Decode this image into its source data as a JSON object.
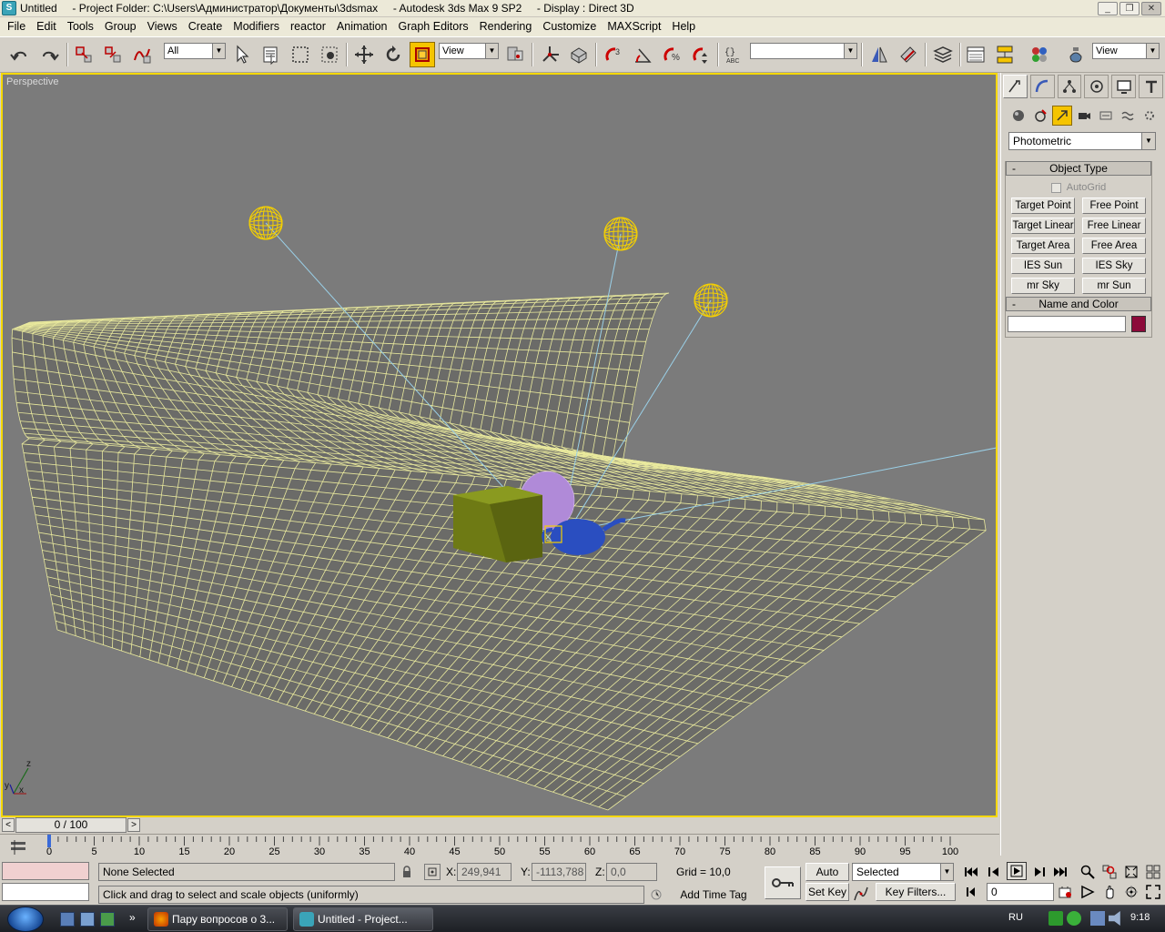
{
  "window": {
    "title": "Untitled     - Project Folder: C:\\Users\\Администратор\\Документы\\3dsmax     - Autodesk 3ds Max 9 SP2     - Display : Direct 3D",
    "minimize": "_",
    "maximize": "❐",
    "close": "✕"
  },
  "menu": [
    "File",
    "Edit",
    "Tools",
    "Group",
    "Views",
    "Create",
    "Modifiers",
    "reactor",
    "Animation",
    "Graph Editors",
    "Rendering",
    "Customize",
    "MAXScript",
    "Help"
  ],
  "toolbar": {
    "selection_filter": "All",
    "ref_coord": "View",
    "named_selection": "",
    "view_right": "View"
  },
  "viewport": {
    "label": "Perspective",
    "axis_z": "z",
    "axis_x": "x",
    "axis_y": "y"
  },
  "command_panel": {
    "category_dropdown": "Photometric",
    "object_type": {
      "title": "Object Type",
      "collapse": "-",
      "autogrid": "AutoGrid",
      "buttons": [
        "Target Point",
        "Free Point",
        "Target Linear",
        "Free Linear",
        "Target Area",
        "Free Area",
        "IES Sun",
        "IES Sky",
        "mr Sky",
        "mr Sun"
      ]
    },
    "name_and_color": {
      "title": "Name and Color",
      "collapse": "-",
      "name_value": "",
      "color": "#8c0a3a"
    }
  },
  "time_slider": {
    "frame_label": "0 / 100",
    "prev": "<",
    "next": ">"
  },
  "trackbar": {
    "ticks": [
      "0",
      "5",
      "10",
      "15",
      "20",
      "25",
      "30",
      "35",
      "40",
      "45",
      "50",
      "55",
      "60",
      "65",
      "70",
      "75",
      "80",
      "85",
      "90",
      "95",
      "100"
    ]
  },
  "status": {
    "selection": "None Selected",
    "prompt": "Click and drag to select and scale objects (uniformly)",
    "x_label": "X:",
    "x_value": "249,941",
    "y_label": "Y:",
    "y_value": "-1113,788",
    "z_label": "Z:",
    "z_value": "0,0",
    "grid": "Grid = 10,0",
    "add_time_tag": "Add Time Tag",
    "auto_key": "Auto Key",
    "set_key": "Set Key",
    "key_mode": "Selected",
    "key_filters": "Key Filters...",
    "current_frame": "0"
  },
  "taskbar": {
    "items": [
      {
        "label": "Пару вопросов о 3...",
        "active": false
      },
      {
        "label": "Untitled     - Project...",
        "active": true
      }
    ],
    "language": "RU",
    "time": "9:18"
  },
  "colors": {
    "viewport_bg": "#7b7b7b",
    "viewport_border": "#f5d800",
    "wire_yellow": "#f0f0a0",
    "light_yellow": "#f5d000",
    "box_green": "#6e7a14",
    "teapot_blue": "#2a4ec0",
    "sphere_purple": "#b08ad8",
    "active_tool": "#f5c400"
  }
}
